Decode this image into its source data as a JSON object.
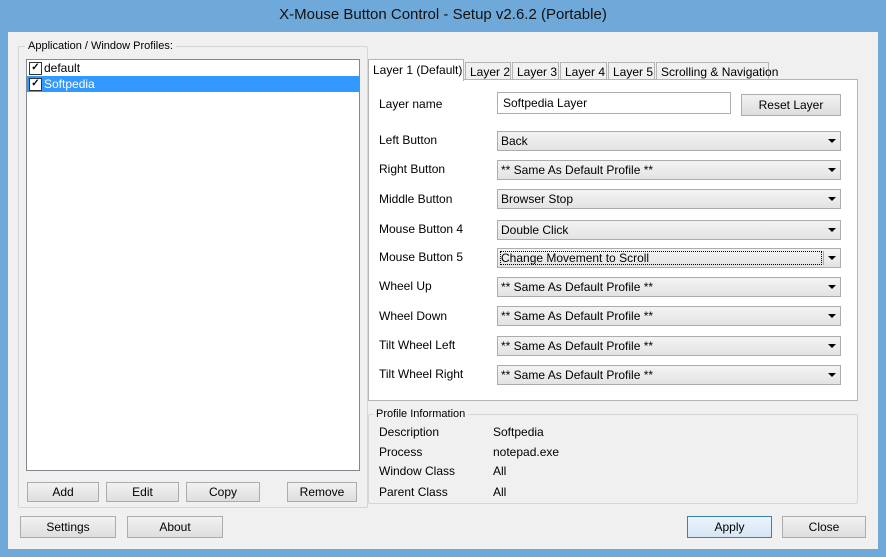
{
  "window": {
    "title": "X-Mouse Button Control - Setup v2.6.2 (Portable)"
  },
  "profiles": {
    "label": "Application / Window Profiles:",
    "items": [
      {
        "label": "default",
        "checked": true,
        "selected": false
      },
      {
        "label": "Softpedia",
        "checked": true,
        "selected": true
      }
    ],
    "buttons": {
      "add": "Add",
      "edit": "Edit",
      "copy": "Copy",
      "remove": "Remove"
    }
  },
  "tabs": [
    "Layer 1 (Default)",
    "Layer 2",
    "Layer 3",
    "Layer 4",
    "Layer 5",
    "Scrolling & Navigation"
  ],
  "layer": {
    "name_label": "Layer name",
    "name_value": "Softpedia Layer",
    "reset_button": "Reset Layer",
    "rows": [
      {
        "label": "Left Button",
        "value": "Back"
      },
      {
        "label": "Right Button",
        "value": "** Same As Default Profile **"
      },
      {
        "label": "Middle Button",
        "value": "Browser Stop"
      },
      {
        "label": "Mouse Button 4",
        "value": "Double Click"
      },
      {
        "label": "Mouse Button 5",
        "value": "Change Movement to Scroll"
      },
      {
        "label": "Wheel Up",
        "value": "** Same As Default Profile **"
      },
      {
        "label": "Wheel Down",
        "value": "** Same As Default Profile **"
      },
      {
        "label": "Tilt Wheel Left",
        "value": "** Same As Default Profile **"
      },
      {
        "label": "Tilt Wheel Right",
        "value": "** Same As Default Profile **"
      }
    ]
  },
  "profile_info": {
    "label": "Profile Information",
    "rows": [
      {
        "label": "Description",
        "value": "Softpedia"
      },
      {
        "label": "Process",
        "value": "notepad.exe"
      },
      {
        "label": "Window Class",
        "value": "All"
      },
      {
        "label": "Parent Class",
        "value": "All"
      }
    ]
  },
  "footer": {
    "settings": "Settings",
    "about": "About",
    "apply": "Apply",
    "close": "Close"
  },
  "colors": {
    "titlebar": "#6fa9d9",
    "selection": "#3399ff"
  }
}
